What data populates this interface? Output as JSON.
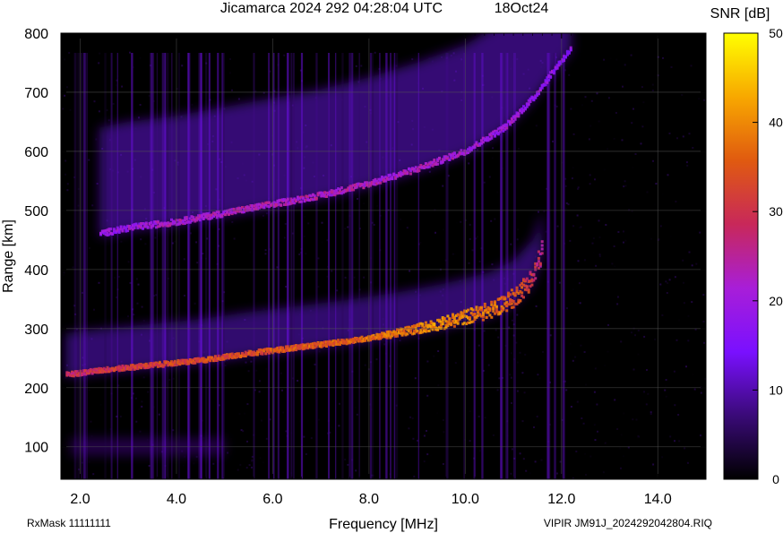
{
  "header": {
    "title": "Jicamarca 2024 292 04:28:04 UTC",
    "date": "18Oct24"
  },
  "footer": {
    "left": "RxMask 11111111",
    "right": "VIPIR  JM91J_2024292042804.RIQ"
  },
  "chart_data": {
    "type": "heatmap",
    "xlabel": "Frequency [MHz]",
    "ylabel": "Range [km]",
    "xlim": [
      1.6,
      15.0
    ],
    "ylim": [
      45,
      800
    ],
    "xticks": [
      2.0,
      4.0,
      6.0,
      8.0,
      10.0,
      12.0,
      14.0
    ],
    "xtick_labels": [
      "2.0",
      "4.0",
      "6.0",
      "8.0",
      "10.0",
      "12.0",
      "14.0"
    ],
    "yticks": [
      100,
      200,
      300,
      400,
      500,
      600,
      700,
      800
    ],
    "ytick_labels": [
      "100",
      "200",
      "300",
      "400",
      "500",
      "600",
      "700",
      "800"
    ],
    "grid": true,
    "colorbar": {
      "label": "SNR [dB]",
      "range": [
        0,
        50
      ],
      "ticks": [
        0,
        10,
        20,
        30,
        40,
        50
      ],
      "tick_labels": [
        "0",
        "10",
        "20",
        "30",
        "40",
        "50"
      ],
      "colormap": [
        "#000000",
        "#3a0a78",
        "#7a10ff",
        "#a81ed8",
        "#c8285a",
        "#e05a10",
        "#f8a800",
        "#ffff00"
      ]
    },
    "series": [
      {
        "name": "",
        "description_key": "o-trace",
        "x": [
          1.7,
          2.5,
          3.5,
          4.5,
          5.5,
          6.5,
          7.5,
          8.5,
          9.5,
          10.5,
          11.0,
          11.4,
          11.6
        ],
        "y": [
          222,
          230,
          238,
          246,
          258,
          268,
          278,
          290,
          305,
          325,
          345,
          380,
          430
        ],
        "snr": [
          28,
          30,
          32,
          33,
          34,
          35,
          36,
          38,
          40,
          38,
          35,
          30,
          25
        ]
      },
      {
        "name": "",
        "description_key": "multihop-trace",
        "x": [
          2.4,
          3.0,
          4.0,
          5.0,
          6.0,
          7.0,
          8.0,
          9.0,
          10.0,
          10.8,
          11.4,
          11.9,
          12.2
        ],
        "y": [
          460,
          470,
          480,
          495,
          510,
          525,
          545,
          570,
          600,
          640,
          690,
          745,
          775
        ],
        "snr": [
          18,
          20,
          22,
          22,
          23,
          23,
          22,
          22,
          21,
          20,
          19,
          18,
          16
        ]
      }
    ]
  }
}
